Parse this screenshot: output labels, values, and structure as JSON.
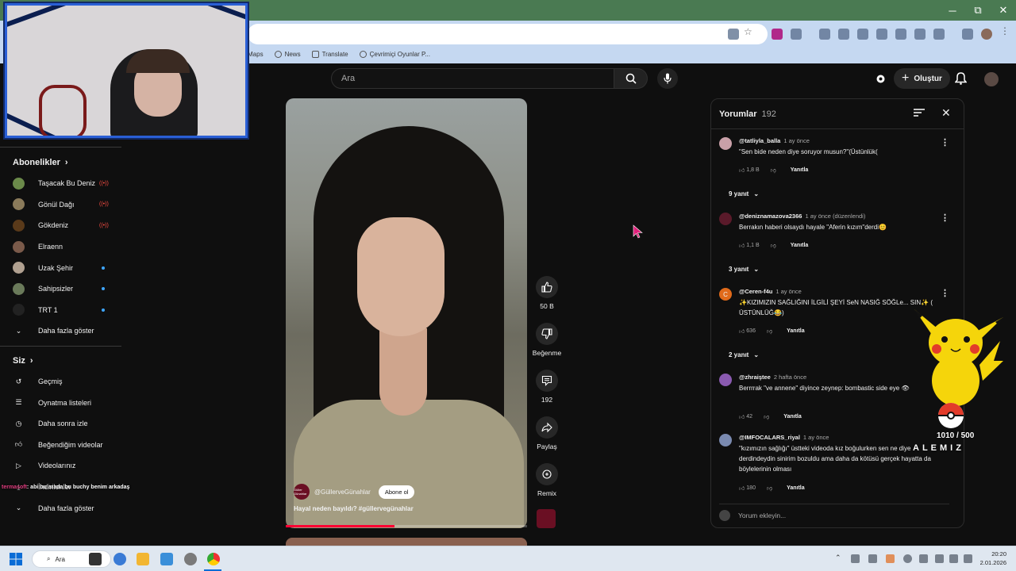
{
  "window": {
    "minimize": "─",
    "restore": "⧉",
    "close": "✕"
  },
  "bookmarks": [
    {
      "label": "Maps"
    },
    {
      "label": "News"
    },
    {
      "label": "Translate"
    },
    {
      "label": "Çevrimiçi Oyunlar P..."
    }
  ],
  "header": {
    "search_placeholder": "Ara",
    "create_label": "Oluştur"
  },
  "sidebar": {
    "subscriptions_title": "Abonelikler",
    "channels": [
      {
        "name": "Taşacak Bu Deniz",
        "indicator": "live",
        "color": "#6b8a4a"
      },
      {
        "name": "Gönül Dağı",
        "indicator": "live",
        "color": "#8a7a5a"
      },
      {
        "name": "Gökdeniz",
        "indicator": "live",
        "color": "#5a3a1a"
      },
      {
        "name": "Elraenn",
        "indicator": "none",
        "color": "#7a5a4a"
      },
      {
        "name": "Uzak Şehir",
        "indicator": "new",
        "color": "#b0a090"
      },
      {
        "name": "Sahipsizler",
        "indicator": "new",
        "color": "#6a7a5a"
      },
      {
        "name": "TRT 1",
        "indicator": "new",
        "color": "#222222"
      }
    ],
    "show_more_1": "Daha fazla göster",
    "you_title": "Siz",
    "you_items": [
      {
        "label": "Geçmiş",
        "icon": "history-icon"
      },
      {
        "label": "Oynatma listeleri",
        "icon": "playlist-icon"
      },
      {
        "label": "Daha sonra izle",
        "icon": "clock-icon"
      },
      {
        "label": "Beğendiğim videolar",
        "icon": "thumbs-up-icon"
      },
      {
        "label": "Videolarınız",
        "icon": "video-icon"
      },
      {
        "label": "İndirilenler",
        "icon": "download-icon"
      }
    ],
    "show_more_2": "Daha fazla göster"
  },
  "short": {
    "channel": "@GüllerveGünahlar",
    "channel_avatar_text": "Güller Günahlar",
    "subscribe_label": "Abone ol",
    "caption": "Hayal neden bayıldı? #güllervegünahlar",
    "progress": 0.45,
    "actions": {
      "like_count": "50 B",
      "dislike_label": "Beğenme",
      "comment_count": "192",
      "share_label": "Paylaş",
      "remix_label": "Remix"
    }
  },
  "comments_panel": {
    "title": "Yorumlar",
    "count": "192",
    "input_placeholder": "Yorum ekleyin...",
    "comments": [
      {
        "user": "@tatliyla_balla",
        "time": "1 ay önce",
        "text": "\"Sen bide neden diye soruyor musun?\"(Üstünlük(",
        "likes": "1,8 B",
        "reply_label": "Yanıtla",
        "replies": "9 yanıt",
        "color": "#c9a0a8"
      },
      {
        "user": "@deniznamazova2366",
        "time": "1 ay önce (düzenlendi)",
        "text": "Berrakın haberi olsaydı hayale \"Aferin kızım\"derdi😊",
        "likes": "1,1 B",
        "reply_label": "Yanıtla",
        "replies": "3 yanıt",
        "color": "#5a1a2a"
      },
      {
        "user": "@Ceren-f4u",
        "time": "1 ay önce",
        "text": "✨KIZIMIZIN SAĞLIĞINI İLGİLİ ŞEYİ SeN NASIĞ SÖĞLe... SIN✨ ( ÜSTÜNLÜĞ😂)",
        "likes": "636",
        "reply_label": "Yanıtla",
        "replies": "2 yanıt",
        "color": "#e06a1a",
        "avatar_letter": "C"
      },
      {
        "user": "@zhraiştee",
        "time": "2 hafta önce",
        "text": "Berrrrak \"ve annene\" diyince zeynep: bombastic side eye 👁",
        "likes": "42",
        "reply_label": "Yanıtla",
        "color": "#8a5ab0"
      },
      {
        "user": "@IMFOCALARS_riyal",
        "time": "1 ay önce",
        "text": "\"kızımızın sağlığı\" üstteki videoda kız boğulurken sen ne diye derdindeydin sinirim bozuldu ama daha da kötüsü gerçek hayatta da böylelerinin olması",
        "likes": "180",
        "reply_label": "Yanıtla",
        "color": "#7a8ab0"
      }
    ]
  },
  "overlay": {
    "goal_text": "1010 / 500",
    "brand_text": "ALEMIZ",
    "chat_user": "termasoft",
    "chat_text": ": abi bu arada bu buchy benim arkadaş"
  },
  "taskbar": {
    "search_label": "Ara",
    "time": "20:20",
    "date": "2.01.2026"
  },
  "colors": {
    "accent": "#ff0033",
    "live": "#ff4e45",
    "new_dot": "#3ea6ff",
    "cam_frame": "#2a5fd6"
  }
}
